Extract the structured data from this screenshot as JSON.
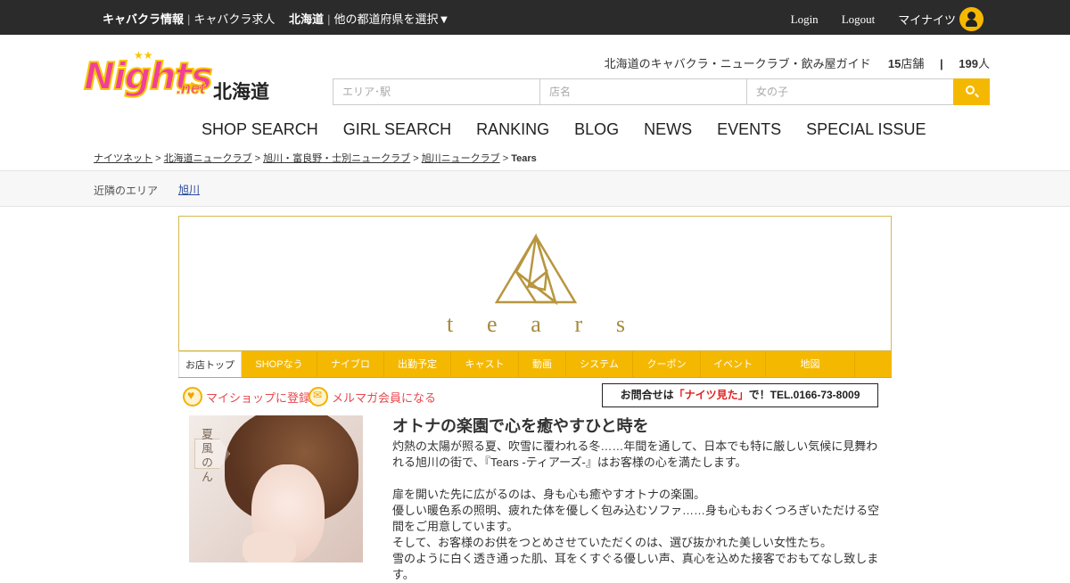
{
  "topbar": {
    "cabakura_info": "キャバクラ情報",
    "cabakura_jobs": "キャバクラ求人",
    "region": "北海道",
    "select_pref": "他の都道府県を選択▼",
    "login": "Login",
    "logout": "Logout",
    "mynights": "マイナイツ"
  },
  "logo": {
    "brand": "Nights",
    "suffix": ".net",
    "region": "北海道"
  },
  "tagline": {
    "text": "北海道のキャバクラ・ニュークラブ・飲み屋ガイド",
    "shops": "15",
    "shops_unit": "店舗",
    "separator": "|",
    "girls": "199",
    "girls_unit": "人"
  },
  "search": {
    "area_placeholder": "エリア･駅",
    "shop_placeholder": "店名",
    "girl_placeholder": "女の子"
  },
  "mainnav": [
    "SHOP SEARCH",
    "GIRL SEARCH",
    "RANKING",
    "BLOG",
    "NEWS",
    "EVENTS",
    "SPECIAL ISSUE"
  ],
  "breadcrumb": {
    "items": [
      "ナイツネット",
      "北海道ニュークラブ",
      "旭川・富良野・士別ニュークラブ",
      "旭川ニュークラブ"
    ],
    "sep": ">",
    "current": "Tears"
  },
  "nearby": {
    "label": "近隣のエリア",
    "link": "旭川"
  },
  "banner": {
    "letters": [
      "t",
      "e",
      "a",
      "r",
      "s"
    ],
    "color": "#a68a3b"
  },
  "shoptabs": [
    "お店トップ",
    "SHOPなう",
    "ナイブロ",
    "出勤予定",
    "キャスト",
    "動画",
    "システム",
    "クーポン",
    "イベント",
    "地図"
  ],
  "actions": {
    "myshop": "マイショップに登録",
    "mailmag": "メルマガ会員になる",
    "contact_pre": "お問合せは",
    "contact_red": "「ナイツ見た」",
    "contact_post": "で！TEL.0166-73-8009"
  },
  "photo": {
    "name": "夏風のん"
  },
  "desc": {
    "title": "オトナの楽園で心を癒やすひと時を",
    "p1": "灼熱の太陽が照る夏、吹雪に覆われる冬……年間を通して、日本でも特に厳しい気候に見舞われる旭川の街で、『Tears -ティアーズ-』はお客様の心を満たします。",
    "p2": "扉を開いた先に広がるのは、身も心も癒やすオトナの楽園。",
    "p3": "優しい暖色系の照明、疲れた体を優しく包み込むソファ……身も心もおくつろぎいただける空間をご用意しています。",
    "p4": "そして、お客様のお供をつとめさせていただくのは、選び抜かれた美しい女性たち。",
    "p5": "雪のように白く透き通った肌、耳をくすぐる優しい声、真心を込めた接客でおもてなし致します。"
  },
  "colors": {
    "accent": "#f5b800",
    "topbar": "#2b2b2b",
    "link": "#2a4b9b",
    "alert": "#e02020"
  }
}
